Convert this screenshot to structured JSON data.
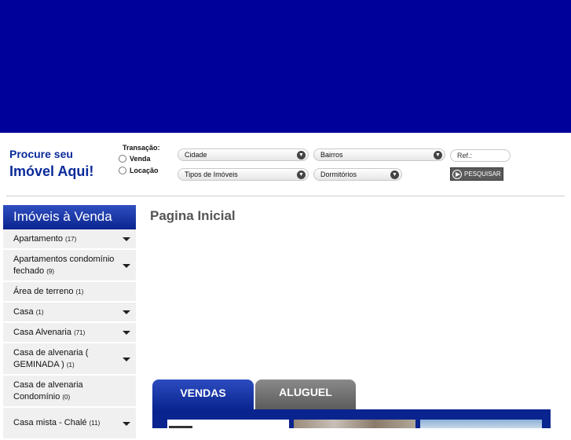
{
  "search": {
    "title_line1": "Procure seu",
    "title_line2": "Imóvel Aqui!",
    "transaction_label": "Transação:",
    "transaction_options": [
      "Venda",
      "Locação"
    ],
    "cidade": "Cidade",
    "bairros": "Bairros",
    "tipos": "Tipos de Imóveis",
    "dormitorios": "Dormitórios",
    "ref": "Ref.:",
    "search_button": "PESQUISAR"
  },
  "sidebar": {
    "heading": "Imóveis à Venda",
    "items": [
      {
        "label": "Apartamento",
        "count": "(17)",
        "expandable": true
      },
      {
        "label": "Apartamentos condomínio fechado",
        "count": "(9)",
        "expandable": true
      },
      {
        "label": "Área de terreno",
        "count": "(1)",
        "expandable": false
      },
      {
        "label": "Casa",
        "count": "(1)",
        "expandable": true
      },
      {
        "label": "Casa Alvenaria",
        "count": "(71)",
        "expandable": true
      },
      {
        "label": "Casa de alvenaria ( GEMINADA )",
        "count": "(1)",
        "expandable": true
      },
      {
        "label": "Casa de alvenaria Condomínio",
        "count": "(0)",
        "expandable": false
      },
      {
        "label": "Casa mista - Chalé",
        "count": "(11)",
        "expandable": true
      }
    ]
  },
  "main": {
    "page_title": "Pagina Inicial",
    "tabs": [
      {
        "label": "VENDAS"
      },
      {
        "label": "ALUGUEL"
      }
    ]
  },
  "colors": {
    "banner": "#00009a",
    "brand_text": "#0a2a9a",
    "tab_active": "#0a248f"
  }
}
